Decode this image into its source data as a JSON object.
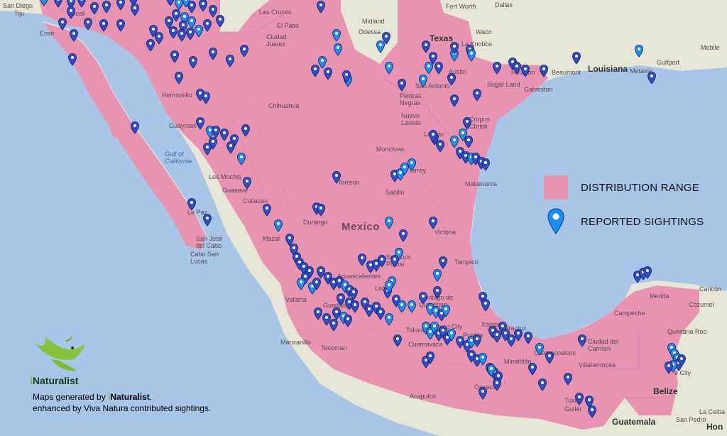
{
  "map": {
    "colors": {
      "water": "#a8c4e6",
      "land": "#e6e6d6",
      "range": "#e993b3",
      "pin_dark": "#2f4cc9",
      "pin_light": "#1e8cf0"
    },
    "place_labels": {
      "san_diego": "San Diego",
      "tijuana": "Tiju",
      "ensenada": "Ense",
      "mexicali": "exicali",
      "las_cruces": "Las Cruces",
      "el_paso": "El Paso",
      "ciudad_juarez": "Ciudad\nJuarez",
      "midland": "Midland",
      "odessa": "Odessa",
      "fort_worth": "Fort Worth",
      "dallas": "Dallas",
      "waco": "Waco",
      "texas": "Texas",
      "la_knobbs": "La Knobbs",
      "austin": "Austin",
      "san_antonio": "San Antonio",
      "houston": "Houston",
      "sugar_land": "Sugar Land",
      "galveston": "Galveston",
      "beaumont": "Beaumont",
      "louisiana": "Louisiana",
      "metairie": "Metairie",
      "gulfport": "Gulfport",
      "mobile": "Mobile",
      "hermosillo": "Hermosillo",
      "chihuahua": "Chihuahua",
      "guaymas": "Guaymas",
      "gulf_of_california": "Gulf of\nCalifornia",
      "los_mochis": "Los Mochis",
      "guasave": "Guasave",
      "culiacan": "Culiacan",
      "la_paz": "La Paz",
      "san_jose_del_cabo": "San José\ndel Cabo",
      "cabo_san_lucas": "Cabo San\nLucas",
      "durango": "Durango",
      "mazatlan": "Mazat",
      "mexico": "Mexico",
      "monclova": "Monclova",
      "monterrey": "terrey",
      "saltillo": "Saltillo",
      "torreon": "Torreon",
      "nuevo_laredo": "Nuevo\nLaredo",
      "piedras_negras": "Piedras\nNegras",
      "laredo": "Laredo",
      "corpus_christi": "Corpus\nChristi",
      "matamoros": "Matamoros",
      "victoria": "Victoria",
      "tampico": "Tampico",
      "san_luis_potosi": "San Luis\nPotosí",
      "aguascalientes": "Aguascalientes",
      "leon": "León",
      "guadalajara": "Guadalajara",
      "puerto_vallarta": "Vallarta",
      "santiago_de_queretaro": "Santiago de\nQuerétaro",
      "toluca": "Toluca",
      "mexico_city": "Mexico City",
      "puebla": "Puebla",
      "veracruz": "Veracruz",
      "xalapa": "Xalapa",
      "cuernavaca": "Cuernavaca",
      "manzanillo": "Manzanillo",
      "tecoman": "Tecoman",
      "acapulco": "Acapulco",
      "oaxaca": "Oaxaca",
      "tuxtla": "Tuxtla",
      "gutierrez": "Gutiér",
      "coatzacoalcos": "Coatzacoalcos",
      "minatitlan": "Minatitlán",
      "villahermosa": "Villahermosa",
      "ciudad_del_carmen": "Ciudad del\nCarmen",
      "campeche": "Campeche",
      "merida": "Merida",
      "cancun": "Cancún",
      "cozumel": "Cozumel",
      "belize": "Belize",
      "belize_city": "e City",
      "guatemala": "Guatemala",
      "la_ceiba": "La Ceiba",
      "san_pedro_sula": "San Pedro",
      "honduras": "Hon",
      "quintana_roo": "Quintana Roo"
    }
  },
  "legend": {
    "distribution_range": "DISTRIBUTION RANGE",
    "reported_sightings": "REPORTED SIGHTINGS"
  },
  "branding": {
    "logo_icon": "bird-leaf-icon",
    "logo_prefix": "i",
    "logo_name": "Naturalist",
    "credit_line1_prefix": "Maps generated by ",
    "credit_line1_brand_i": "i",
    "credit_line1_brand": "Naturalist",
    "credit_line1_suffix": ",",
    "credit_line2": "enhanced by Viva Natura contributed sightings."
  }
}
